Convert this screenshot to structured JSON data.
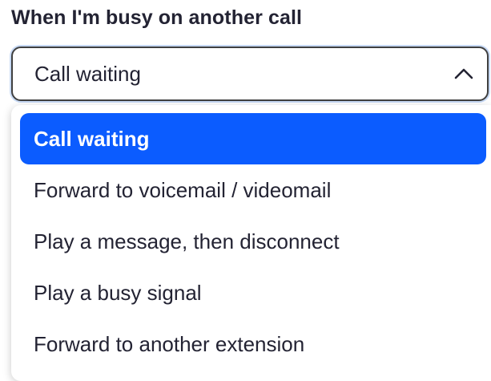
{
  "setting": {
    "label": "When I'm busy on another call",
    "selected_value": "Call waiting",
    "expanded_icon": "chevron-up-icon"
  },
  "options": [
    {
      "label": "Call waiting",
      "selected": true
    },
    {
      "label": "Forward to voicemail / videomail",
      "selected": false
    },
    {
      "label": "Play a message, then disconnect",
      "selected": false
    },
    {
      "label": "Play a busy signal",
      "selected": false
    },
    {
      "label": "Forward to another extension",
      "selected": false
    }
  ],
  "colors": {
    "accent": "#0b5cff",
    "text": "#232333",
    "border": "#404040",
    "focus_ring": "#c8daf5"
  }
}
